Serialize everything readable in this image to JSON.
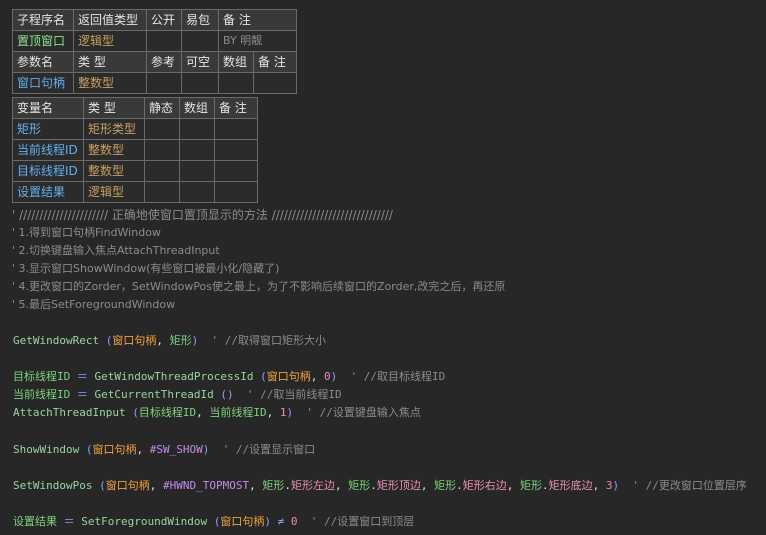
{
  "sub_header": {
    "name": "子程序名",
    "ret": "返回值类型",
    "pub": "公开",
    "easy": "易包",
    "note": "备 注"
  },
  "sub_row": {
    "name": "置顶窗口",
    "ret": "逻辑型",
    "note": "BY 明靓"
  },
  "param_header": {
    "name": "参数名",
    "type": "类 型",
    "ref": "参考",
    "opt": "可空",
    "arr": "数组",
    "note": "备 注"
  },
  "param_row": {
    "name": "窗口句柄",
    "type": "整数型"
  },
  "var_header": {
    "name": "变量名",
    "type": "类 型",
    "static": "静态",
    "arr": "数组",
    "note": "备 注"
  },
  "vars": [
    {
      "name": "矩形",
      "type": "矩形类型"
    },
    {
      "name": "当前线程ID",
      "type": "整数型"
    },
    {
      "name": "目标线程ID",
      "type": "整数型"
    },
    {
      "name": "设置结果",
      "type": "逻辑型"
    }
  ],
  "comments": {
    "c0": "' //////////////////////     正确地使窗口置顶显示的方法    //////////////////////////////",
    "c1": "' 1.得到窗口句柄FindWindow",
    "c2": "' 2.切换键盘输入焦点AttachThreadInput",
    "c3": "' 3.显示窗口ShowWindow(有些窗口被最小化/隐藏了)",
    "c4": "' 4.更改窗口的Zorder，SetWindowPos使之最上，为了不影响后续窗口的Zorder,改完之后，再还原",
    "c5": "' 5.最后SetForegroundWindow"
  },
  "code": {
    "l1": {
      "fn": "GetWindowRect",
      "a1": "窗口句柄",
      "a2": "矩形",
      "cmt": "' //取得窗口矩形大小"
    },
    "l2": {
      "var": "目标线程ID",
      "fn": "GetWindowThreadProcessId",
      "a1": "窗口句柄",
      "n": "0",
      "cmt": "' //取目标线程ID"
    },
    "l3": {
      "var": "当前线程ID",
      "fn": "GetCurrentThreadId",
      "cmt": "' //取当前线程ID"
    },
    "l4": {
      "fn": "AttachThreadInput",
      "a1": "目标线程ID",
      "a2": "当前线程ID",
      "n": "1",
      "cmt": "' //设置键盘输入焦点"
    },
    "l5": {
      "fn": "ShowWindow",
      "a1": "窗口句柄",
      "c": "#SW_SHOW",
      "cmt": "' //设置显示窗口"
    },
    "l6": {
      "fn": "SetWindowPos",
      "a1": "窗口句柄",
      "c": "#HWND_TOPMOST",
      "rect": "矩形",
      "f1": "矩形左边",
      "f2": "矩形顶边",
      "f3": "矩形右边",
      "f4": "矩形底边",
      "n": "3",
      "cmt": "' //更改窗口位置层序"
    },
    "l7": {
      "var": "设置结果",
      "fn": "SetForegroundWindow",
      "a1": "窗口句柄",
      "ne": "≠",
      "n": "0",
      "cmt": "' //设置窗口到顶层"
    }
  }
}
